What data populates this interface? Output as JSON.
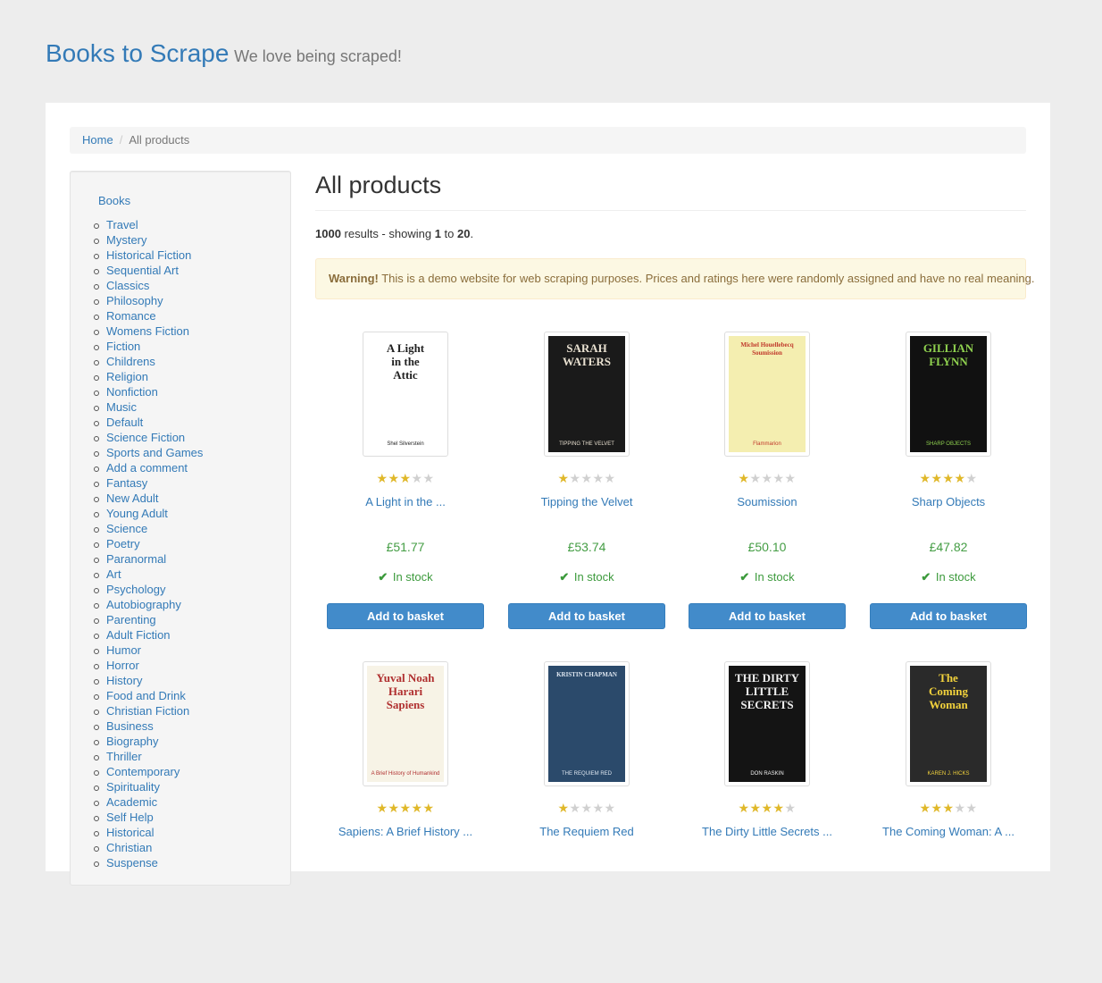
{
  "site": {
    "brand": "Books to Scrape",
    "tagline": "We love being scraped!"
  },
  "breadcrumb": {
    "home": "Home",
    "separator": "/",
    "current": "All products"
  },
  "sidebar": {
    "root": "Books",
    "categories": [
      "Travel",
      "Mystery",
      "Historical Fiction",
      "Sequential Art",
      "Classics",
      "Philosophy",
      "Romance",
      "Womens Fiction",
      "Fiction",
      "Childrens",
      "Religion",
      "Nonfiction",
      "Music",
      "Default",
      "Science Fiction",
      "Sports and Games",
      "Add a comment",
      "Fantasy",
      "New Adult",
      "Young Adult",
      "Science",
      "Poetry",
      "Paranormal",
      "Art",
      "Psychology",
      "Autobiography",
      "Parenting",
      "Adult Fiction",
      "Humor",
      "Horror",
      "History",
      "Food and Drink",
      "Christian Fiction",
      "Business",
      "Biography",
      "Thriller",
      "Contemporary",
      "Spirituality",
      "Academic",
      "Self Help",
      "Historical",
      "Christian",
      "Suspense"
    ]
  },
  "main": {
    "title": "All products",
    "results": {
      "total": "1000",
      "text_mid": " results - showing ",
      "from": "1",
      "to_word": " to ",
      "to": "20",
      "end": "."
    },
    "alert": {
      "strong": "Warning!",
      "text": " This is a demo website for web scraping purposes. Prices and ratings here were randomly assigned and have no real meaning."
    },
    "add_label": "Add to basket",
    "stock_label": "In stock",
    "products": [
      {
        "title": "A Light in the ...",
        "rating": 3,
        "price": "£51.77"
      },
      {
        "title": "Tipping the Velvet",
        "rating": 1,
        "price": "£53.74"
      },
      {
        "title": "Soumission",
        "rating": 1,
        "price": "£50.10"
      },
      {
        "title": "Sharp Objects",
        "rating": 4,
        "price": "£47.82"
      },
      {
        "title": "Sapiens: A Brief History ...",
        "rating": 5
      },
      {
        "title": "The Requiem Red",
        "rating": 1
      },
      {
        "title": "The Dirty Little Secrets ...",
        "rating": 4
      },
      {
        "title": "The Coming Woman: A ...",
        "rating": 3
      }
    ]
  },
  "covers": [
    {
      "bg": "#ffffff",
      "fg": "#222222",
      "lines": [
        "A Light",
        "in the",
        "Attic"
      ],
      "small": "Shel Silverstein"
    },
    {
      "bg": "#1a1a1a",
      "fg": "#e8e0d0",
      "lines": [
        "SARAH",
        "WATERS"
      ],
      "small": "TIPPING THE VELVET"
    },
    {
      "bg": "#f4eeb0",
      "fg": "#c0392b",
      "lines": [
        "Michel Houellebecq",
        "Soumission"
      ],
      "small": "Flammarion"
    },
    {
      "bg": "#111111",
      "fg": "#8fd14f",
      "lines": [
        "GILLIAN",
        "FLYNN"
      ],
      "small": "SHARP OBJECTS"
    },
    {
      "bg": "#f7f3e6",
      "fg": "#b03030",
      "lines": [
        "Yuval Noah",
        "Harari",
        "Sapiens"
      ],
      "small": "A Brief History of Humankind"
    },
    {
      "bg": "#2b4a6b",
      "fg": "#dde6f0",
      "lines": [
        "KRISTIN CHAPMAN"
      ],
      "small": "THE REQUIEM RED"
    },
    {
      "bg": "#141414",
      "fg": "#f0f0f0",
      "lines": [
        "THE DIRTY",
        "LITTLE",
        "SECRETS"
      ],
      "small": "DON RASKIN"
    },
    {
      "bg": "#2a2a2a",
      "fg": "#f2d23c",
      "lines": [
        "The",
        "Coming",
        "Woman"
      ],
      "small": "KAREN J. HICKS"
    }
  ]
}
